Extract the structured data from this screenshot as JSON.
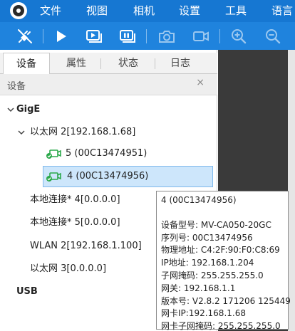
{
  "menu": {
    "items": [
      "文件",
      "视图",
      "相机",
      "设置",
      "工具",
      "语言"
    ]
  },
  "toolbar": {
    "buttons": [
      "disconnect-icon",
      "play-icon",
      "continuous-capture-icon",
      "stop-capture-icon",
      "snapshot-camera-icon",
      "record-video-icon",
      "zoom-in-icon",
      "zoom-out-icon"
    ]
  },
  "panel": {
    "tabs": [
      "设备",
      "属性",
      "状态",
      "日志"
    ],
    "active_tab": "设备",
    "title": "设备",
    "close_glyph": "×"
  },
  "tree": {
    "gige": "GigE",
    "eth2": "以太网 2[192.168.1.68]",
    "cam5": "5 (00C13474951)",
    "cam4": "4 (00C13474956)",
    "local4": "本地连接* 4[0.0.0.0]",
    "local5": "本地连接* 5[0.0.0.0]",
    "wlan2": "WLAN 2[192.168.1.100]",
    "eth3": "以太网 3[0.0.0.0]",
    "usb": "USB"
  },
  "tooltip": {
    "title": "4 (00C13474956)",
    "lines": [
      "设备型号: MV-CA050-20GC",
      "序列号: 00C13474956",
      "物理地址: C4:2F:90:F0:C8:69",
      "IP地址: 192.168.1.204",
      "子网掩码: 255.255.255.0",
      "网关: 192.168.1.1",
      "版本号: V2.8.2 171206 125449",
      "网卡IP:192.168.1.68",
      "网卡子网掩码: 255.255.255.0"
    ]
  },
  "colors": {
    "menubar": "#1677d2",
    "toolbar": "#1f83dd",
    "selection": "#cde6fb",
    "camera_green": "#2aa84a"
  }
}
